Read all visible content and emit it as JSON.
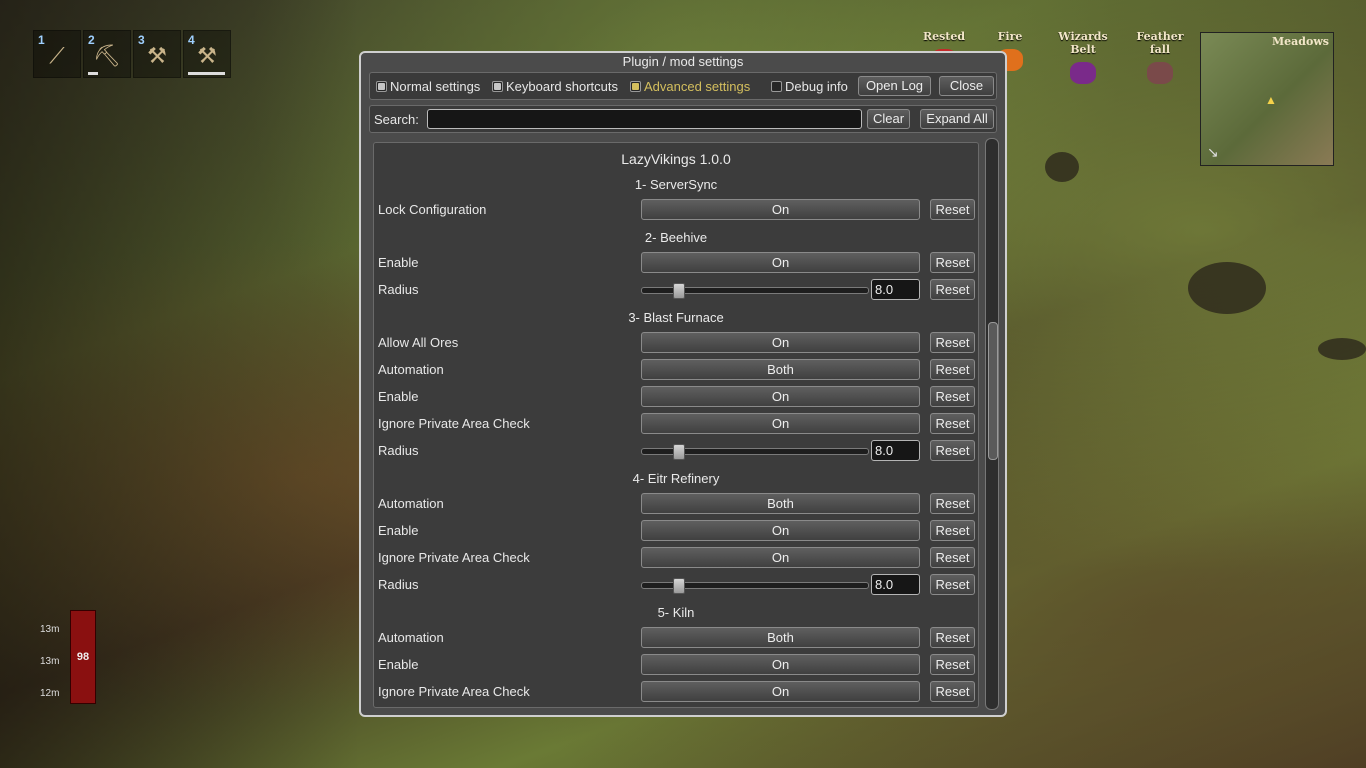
{
  "hud": {
    "hotbar": [
      {
        "num": "1",
        "icon": "bow-icon"
      },
      {
        "num": "2",
        "icon": "pickaxe-icon",
        "durability": 0.25
      },
      {
        "num": "3",
        "icon": "axe-icon"
      },
      {
        "num": "4",
        "icon": "hammer-icon",
        "durability": 0.85
      }
    ],
    "statuses": [
      {
        "label": "Rested",
        "icon": "rested-icon",
        "color": "#c42a2a"
      },
      {
        "label": "Fire",
        "icon": "fire-icon",
        "color": "#e0701c"
      },
      {
        "label": "Wizards Belt",
        "icon": "wizards-belt-icon",
        "color": "#7a2a8a"
      },
      {
        "label": "Feather fall",
        "icon": "feather-icon",
        "color": "#7a4a4a"
      }
    ],
    "minimap": {
      "biome": "Meadows"
    },
    "stats": {
      "stat1": "13m",
      "stat2": "13m",
      "stat3": "12m",
      "health": "98"
    }
  },
  "window": {
    "title": "Plugin / mod settings",
    "toolbar": {
      "normal": "Normal settings",
      "keyboard": "Keyboard shortcuts",
      "advanced": "Advanced settings",
      "debug": "Debug info",
      "open_log": "Open Log",
      "close": "Close"
    },
    "search": {
      "label": "Search:",
      "value": "",
      "clear": "Clear",
      "expand": "Expand All"
    },
    "plugin": "LazyVikings 1.0.0",
    "reset_label": "Reset",
    "sections": [
      {
        "title": "1- ServerSync",
        "rows": [
          {
            "name": "Lock Configuration",
            "type": "toggle",
            "value": "On"
          }
        ]
      },
      {
        "title": "2- Beehive",
        "rows": [
          {
            "name": "Enable",
            "type": "toggle",
            "value": "On"
          },
          {
            "name": "Radius",
            "type": "slider",
            "value": "8.0",
            "fraction": 0.16
          }
        ]
      },
      {
        "title": "3- Blast Furnace",
        "rows": [
          {
            "name": "Allow All Ores",
            "type": "toggle",
            "value": "On"
          },
          {
            "name": "Automation",
            "type": "toggle",
            "value": "Both"
          },
          {
            "name": "Enable",
            "type": "toggle",
            "value": "On"
          },
          {
            "name": "Ignore Private Area Check",
            "type": "toggle",
            "value": "On"
          },
          {
            "name": "Radius",
            "type": "slider",
            "value": "8.0",
            "fraction": 0.16
          }
        ]
      },
      {
        "title": "4- Eitr Refinery",
        "rows": [
          {
            "name": "Automation",
            "type": "toggle",
            "value": "Both"
          },
          {
            "name": "Enable",
            "type": "toggle",
            "value": "On"
          },
          {
            "name": "Ignore Private Area Check",
            "type": "toggle",
            "value": "On"
          },
          {
            "name": "Radius",
            "type": "slider",
            "value": "8.0",
            "fraction": 0.16
          }
        ]
      },
      {
        "title": "5- Kiln",
        "rows": [
          {
            "name": "Automation",
            "type": "toggle",
            "value": "Both"
          },
          {
            "name": "Enable",
            "type": "toggle",
            "value": "On"
          },
          {
            "name": "Ignore Private Area Check",
            "type": "toggle",
            "value": "On"
          }
        ]
      }
    ],
    "accent_color": "#d4bf5e"
  }
}
